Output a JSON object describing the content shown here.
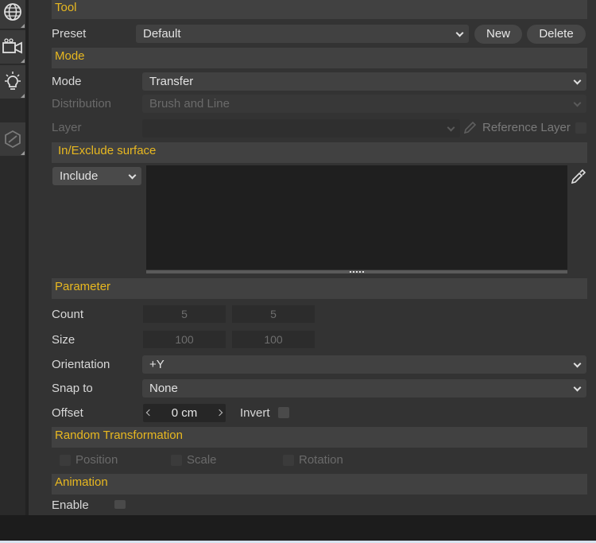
{
  "sidebar": {
    "items": [
      {
        "icon": "globe-icon"
      },
      {
        "icon": "camera-icon"
      },
      {
        "icon": "light-bulb-icon"
      },
      {
        "icon": "cube-outline-icon"
      }
    ]
  },
  "sections": {
    "tool": "Tool",
    "mode": "Mode",
    "include_exclude": "In/Exclude surface",
    "parameter": "Parameter",
    "random_transformation": "Random Transformation",
    "animation": "Animation"
  },
  "tool": {
    "preset_label": "Preset",
    "preset_value": "Default",
    "new_button": "New",
    "delete_button": "Delete"
  },
  "mode": {
    "mode_label": "Mode",
    "mode_value": "Transfer",
    "distribution_label": "Distribution",
    "distribution_value": "Brush and Line",
    "layer_label": "Layer",
    "layer_value": "",
    "reference_layer_label": "Reference Layer"
  },
  "include_exclude": {
    "include_value": "Include"
  },
  "parameter": {
    "count_label": "Count",
    "count_values": [
      "5",
      "5"
    ],
    "size_label": "Size",
    "size_values": [
      "100",
      "100"
    ],
    "orientation_label": "Orientation",
    "orientation_value": "+Y",
    "snap_label": "Snap to",
    "snap_value": "None",
    "offset_label": "Offset",
    "offset_value": "0 cm",
    "invert_label": "Invert"
  },
  "random_transformation": {
    "position_label": "Position",
    "scale_label": "Scale",
    "rotation_label": "Rotation"
  },
  "animation": {
    "enable_label": "Enable"
  },
  "colors": {
    "section_header": "#e8b820",
    "panel_bg": "#333333"
  }
}
